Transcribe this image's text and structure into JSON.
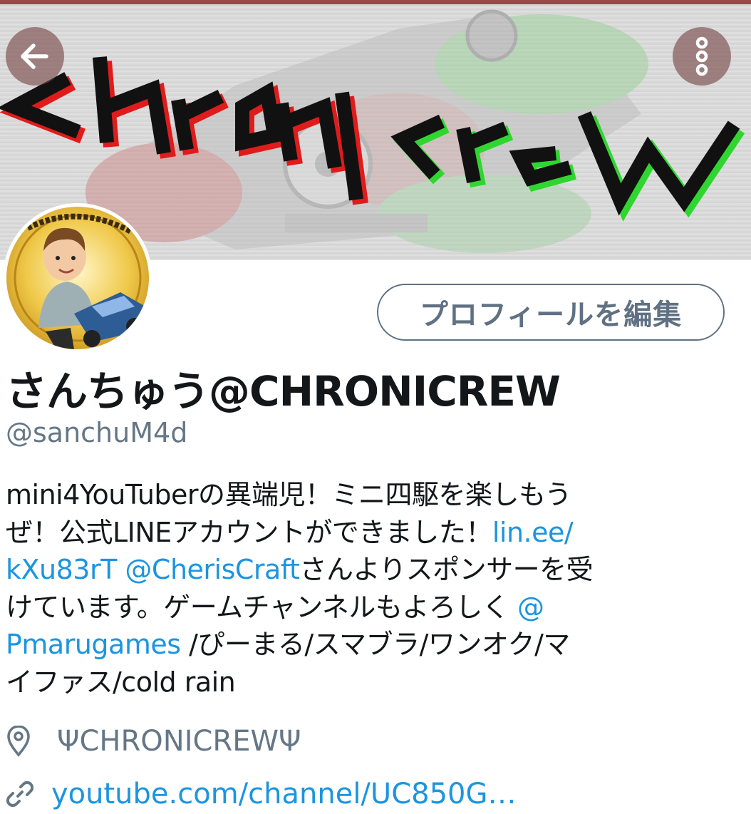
{
  "banner": {
    "logo_text": "ChRoNiCrew",
    "colors": {
      "top_line": "#9a4848",
      "logo_red": "#e01b1b",
      "logo_green": "#2fd62f"
    }
  },
  "navigation": {
    "back_icon": "arrow-left-icon",
    "more_icon": "more-vertical-icon"
  },
  "avatar": {
    "ring_text": "さんちゅう@CHRONICREW"
  },
  "edit_profile": {
    "label": "プロフィールを編集"
  },
  "profile": {
    "display_name": "さんちゅう@CHRONICREW",
    "handle": "@sanchuM4d"
  },
  "bio": {
    "l1": "mini4YouTuberの異端児！ミニ四駆を楽しもう",
    "l2_text": "ぜ！公式LINEアカウントができました！",
    "link_line": "lin.ee/",
    "link_line_rest": "kXu83rT",
    "mention_cheris": "@CherisCraft",
    "l3_text": "さんよりスポンサーを受",
    "l4_text": "けています。ゲームチャンネルもよろしく ",
    "mention_pmaru_at": "@",
    "mention_pmaru_name": "Pmarugames",
    "l5_text": " /ぴーまる/スマブラ/ワンオク/マ",
    "l6_text": "イファス/cold rain"
  },
  "location": {
    "icon": "location-pin-icon",
    "text": "ΨCHRONICREWΨ"
  },
  "website": {
    "icon": "link-icon",
    "text": "youtube.com/channel/UC850G…"
  },
  "colors": {
    "link": "#1b95e0",
    "secondary_text": "#657786",
    "primary_text": "#14171a",
    "button_border": "#5f7183"
  }
}
